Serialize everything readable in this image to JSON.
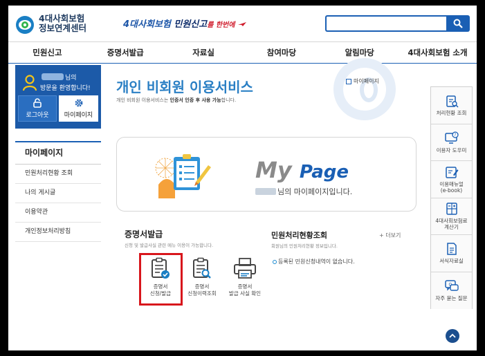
{
  "header": {
    "logo_line1": "4대사회보험",
    "logo_line2": "정보연계센터",
    "banner_part1": "4대사회보험 ",
    "banner_part2": "민원신고",
    "banner_part3": "를 ",
    "banner_part4": "한번에",
    "search_placeholder": ""
  },
  "nav": [
    "민원신고",
    "증명서발급",
    "자료실",
    "참여마당",
    "알림마당",
    "4대사회보험 소개"
  ],
  "userbox": {
    "greet_suffix": "님의",
    "greet_line2": "방문을 환영합니다!",
    "logout_label": "로그아웃",
    "mypage_label": "마이페이지"
  },
  "sidebar": {
    "title": "마이페이지",
    "items": [
      "민원처리현황 조회",
      "나의 게시글",
      "이용약관",
      "개인정보처리방침"
    ]
  },
  "main": {
    "title": "개인 비회원 이용서비스",
    "sub_pre": "개인 비회원 이용서비스는 ",
    "sub_bold": "인증서 인증 후 사용 가능",
    "sub_post": "합니다.",
    "breadcrumb": "마이페이지"
  },
  "mypage_banner": {
    "my": "My",
    "page": "Page",
    "greeting": "님의 마이페이지입니다."
  },
  "cert": {
    "title": "증명서발급",
    "subtitle": "신청 및 발급사실 관련 메뉴 이용이 가능합니다.",
    "items": [
      {
        "line1": "증명서",
        "line2": "신청/발급"
      },
      {
        "line1": "증명서",
        "line2": "신청이력조회"
      },
      {
        "line1": "증명서",
        "line2": "발급 사실 확인"
      }
    ]
  },
  "status": {
    "title": "민원처리현황조회",
    "subtitle": "회원님의 민원처리현황 정보입니다.",
    "more": "+ 더보기",
    "empty": "등록된 민원신청내역이 없습니다."
  },
  "quick_menu": [
    {
      "line1": "처리현황 조회",
      "line2": ""
    },
    {
      "line1": "이용자 도우미",
      "line2": ""
    },
    {
      "line1": "이용매뉴얼",
      "line2": "(e-book)"
    },
    {
      "line1": "4대사회보험료",
      "line2": "계산기"
    },
    {
      "line1": "서식자료실",
      "line2": ""
    },
    {
      "line1": "자주 묻는 질문",
      "line2": ""
    }
  ],
  "colors": {
    "primary": "#1a5fb4",
    "title_blue": "#2a7fc4",
    "highlight_red": "#d8161c"
  }
}
